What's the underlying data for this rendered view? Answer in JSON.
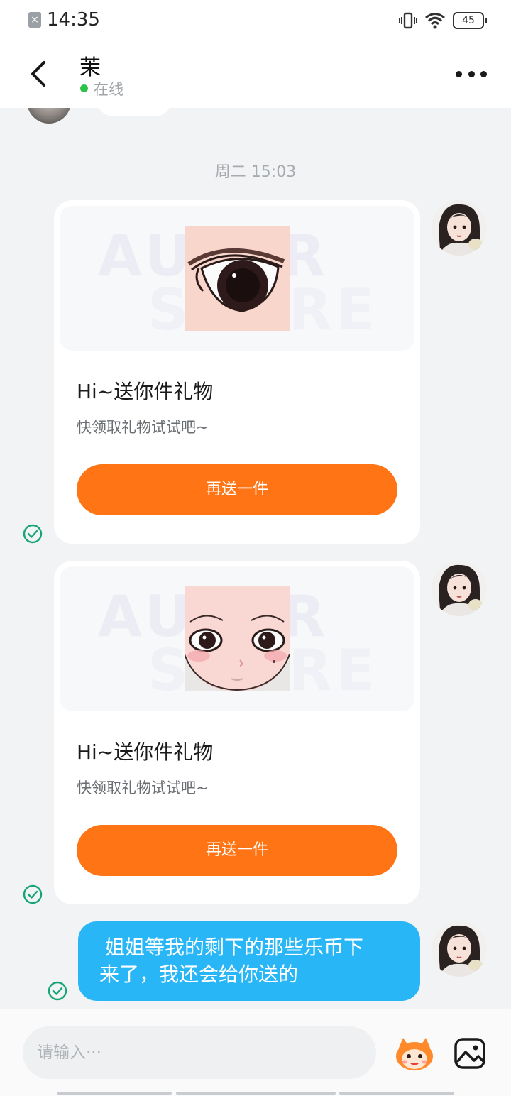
{
  "status_bar": {
    "time": "14:35",
    "battery": "45",
    "notif_glyph": "×"
  },
  "header": {
    "contact_name": "茉",
    "online_status": "在线"
  },
  "chat": {
    "timestamp": "周二 15:03",
    "gift_cards": [
      {
        "title": "Hi~送你件礼物",
        "subtitle": "快领取礼物试试吧~",
        "button_label": "再送一件",
        "item": "eye"
      },
      {
        "title": "Hi~送你件礼物",
        "subtitle": "快领取礼物试试吧~",
        "button_label": "再送一件",
        "item": "face"
      }
    ],
    "text_message": {
      "lines": [
        "姐姐等我的剩下的那些乐币下",
        "来了，我还会给你送的"
      ]
    }
  },
  "input": {
    "placeholder": "请输入···"
  },
  "colors": {
    "accent_orange": "#ff7414",
    "bubble_blue": "#29b6f6",
    "online_green": "#2fc24a",
    "check_teal": "#17a673"
  },
  "icons": [
    "back-arrow-icon",
    "more-dots-icon",
    "check-circle-icon",
    "emoji-mascot-icon",
    "image-icon",
    "vibrate-icon",
    "wifi-icon",
    "battery-icon"
  ]
}
